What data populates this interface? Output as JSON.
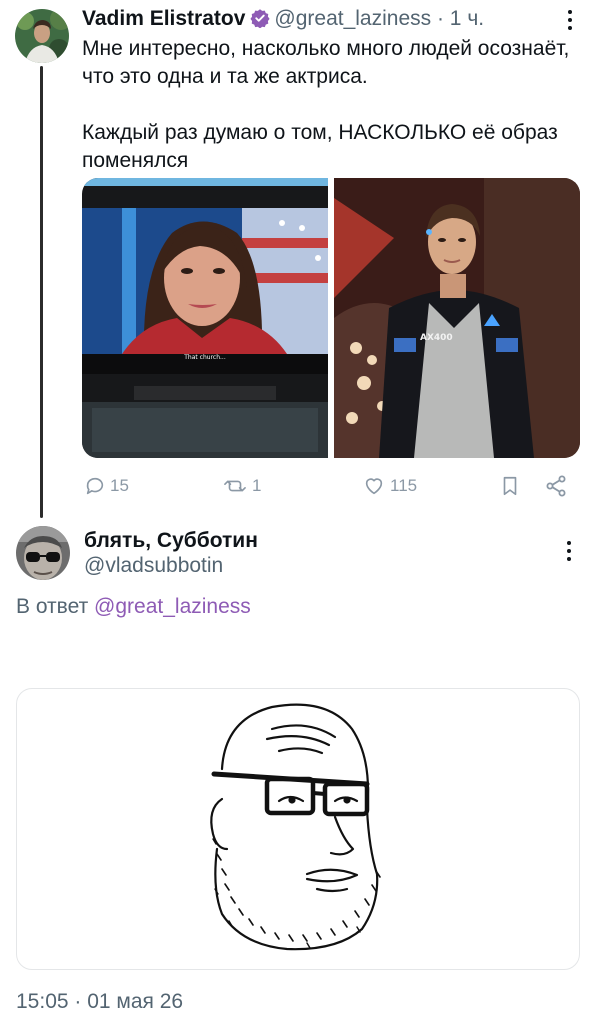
{
  "tweet": {
    "author_name": "Vadim Elistratov",
    "handle": "@great_laziness",
    "time": " · 1 ч.",
    "text": "Мне интересно, насколько много людей осознаёт, что это одна и та же актриса.\n\nКаждый раз думаю о том, НАСКОЛЬКО её образ поменялся",
    "media_caption": "That church...",
    "media_badge": "AX400",
    "actions": {
      "replies": "15",
      "retweets": "1",
      "likes": "115"
    }
  },
  "reply": {
    "author_name": "блять, Субботин",
    "handle": "@vladsubbotin",
    "reply_prefix": "В ответ ",
    "reply_mention": "@great_laziness",
    "timestamp": "15:05 · 01 мая 26"
  },
  "colors": {
    "verified_badge": "#8e5bb5",
    "mention": "#8e5bb5",
    "muted_text": "#536471",
    "action_icons": "#8b98a5",
    "thread_line": "#2b2b2b"
  },
  "icons": {
    "verified": "verified-badge-icon",
    "more": "more-vertical-icon",
    "reply": "reply-icon",
    "retweet": "retweet-icon",
    "like": "heart-icon",
    "bookmark": "bookmark-icon",
    "share": "share-icon"
  }
}
